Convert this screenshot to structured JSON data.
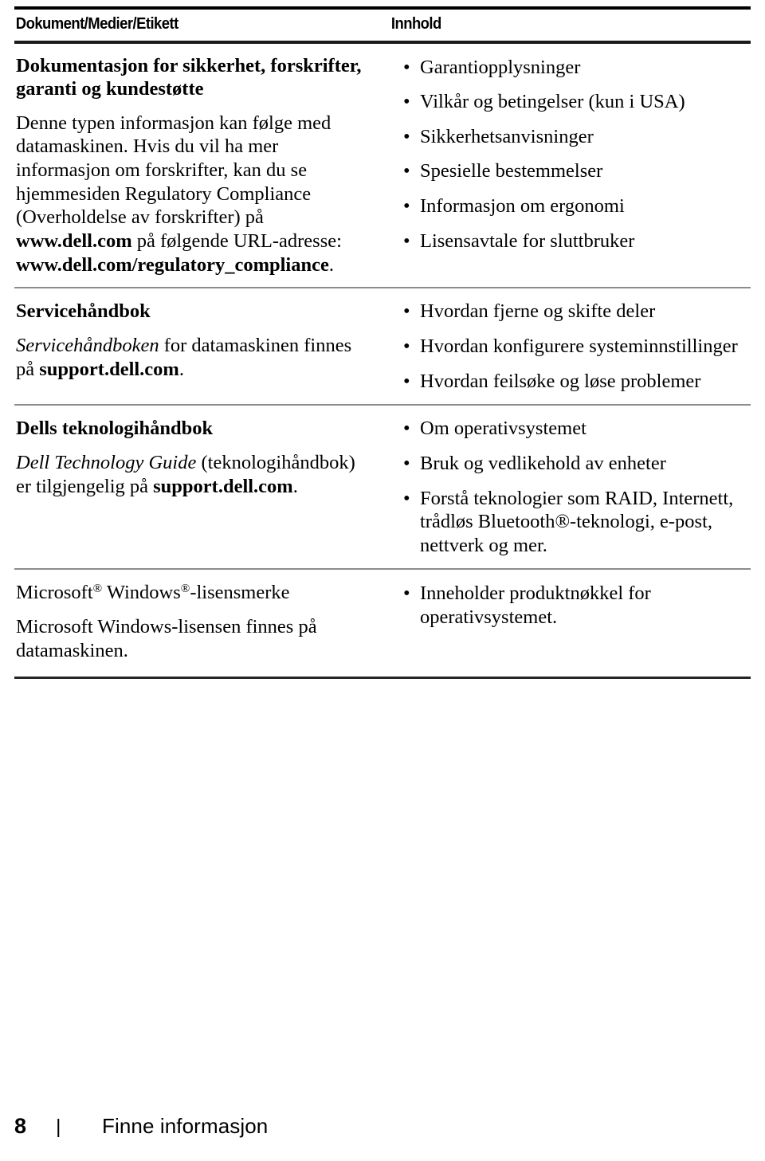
{
  "table": {
    "headers": {
      "left": "Dokument/Medier/Etikett",
      "right": "Innhold"
    },
    "rows": [
      {
        "left": {
          "heading": "Dokumentasjon for sikkerhet, forskrifter, garanti og kundestøtte",
          "body_1": "Denne typen informasjon kan følge med datamaskinen. Hvis du vil ha mer informasjon om forskrifter, kan du se hjemmesiden Regulatory Compliance (Overholdelse av forskrifter) på ",
          "body_url_1": "www.dell.com",
          "body_2": " på følgende URL-adresse: ",
          "body_url_2": "www.dell.com/regulatory_compliance",
          "body_3": "."
        },
        "right_items": [
          "Garantiopplysninger",
          "Vilkår og betingelser (kun i USA)",
          "Sikkerhetsanvisninger",
          "Spesielle bestemmelser",
          "Informasjon om ergonomi",
          "Lisensavtale for sluttbruker"
        ]
      },
      {
        "left": {
          "heading": "Servicehåndbok",
          "body_ital": "Servicehåndboken",
          "body_1": " for datamaskinen finnes på ",
          "body_url_1": "support.dell.com",
          "body_2": "."
        },
        "right_items": [
          "Hvordan fjerne og skifte deler",
          "Hvordan konfigurere systeminnstillinger",
          "Hvordan feilsøke og løse problemer"
        ]
      },
      {
        "left": {
          "heading": "Dells teknologihåndbok",
          "body_ital": "Dell Technology Guide",
          "body_1": " (teknologihåndbok) er tilgjengelig på ",
          "body_url_1": "support.dell.com",
          "body_2": "."
        },
        "right_items": [
          "Om operativsystemet",
          "Bruk og vedlikehold av enheter",
          "Forstå teknologier som RAID, Internett, trådløs Bluetooth®-teknologi, e-post, nettverk og mer."
        ]
      },
      {
        "left": {
          "heading_pre": "Microsoft",
          "heading_mid": " Windows",
          "heading_post": "-lisensmerke",
          "body_1": "Microsoft Windows-lisensen finnes på datamaskinen."
        },
        "right_items": [
          "Inneholder produktnøkkel for operativsystemet."
        ]
      }
    ]
  },
  "footer": {
    "page_number": "8",
    "separator": "|",
    "section_title": "Finne informasjon"
  },
  "symbols": {
    "bullet": "•",
    "registered": "®"
  },
  "colors": {
    "text": "#000000",
    "rule_thick": "#000000",
    "rule_thin": "#8c8c8c",
    "background": "#ffffff"
  }
}
